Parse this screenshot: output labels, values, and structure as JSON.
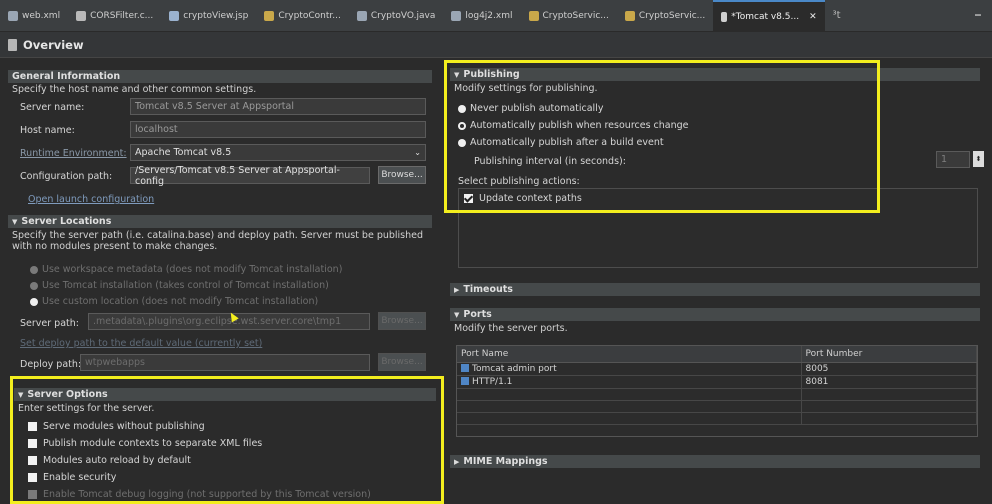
{
  "tabs": [
    {
      "label": "web.xml",
      "icon": "xml-file-icon",
      "color": "#9aa6b4"
    },
    {
      "label": "CORSFilter.c...",
      "icon": "java-file-icon",
      "color": "#b9b9b9"
    },
    {
      "label": "cryptoView.jsp",
      "icon": "jsp-file-icon",
      "color": "#9ab2cf"
    },
    {
      "label": "CryptoContr...",
      "icon": "java-class-icon",
      "color": "#c9a84a"
    },
    {
      "label": "CryptoVO.java",
      "icon": "java-file-icon",
      "color": "#9aa6b4"
    },
    {
      "label": "log4j2.xml",
      "icon": "xml-file-icon",
      "color": "#9aa6b4"
    },
    {
      "label": "CryptoServic...",
      "icon": "java-class-icon",
      "color": "#c9a84a"
    },
    {
      "label": "CryptoServic...",
      "icon": "java-class-icon",
      "color": "#c9a84a"
    },
    {
      "label": "*Tomcat v8.5...",
      "icon": "server-icon",
      "color": "#cfcfcf",
      "active": true
    }
  ],
  "tab_overflow": "³t",
  "editor_title": "Overview",
  "general": {
    "title": "General Information",
    "desc": "Specify the host name and other common settings.",
    "server_name_label": "Server name:",
    "server_name_value": "Tomcat v8.5 Server at Appsportal",
    "host_name_label": "Host name:",
    "host_name_value": "localhost",
    "runtime_label": "Runtime Environment:",
    "runtime_value": "Apache Tomcat v8.5",
    "config_label": "Configuration path:",
    "config_value": "/Servers/Tomcat v8.5 Server at Appsportal-config",
    "browse_label": "Browse...",
    "open_launch": "Open launch configuration"
  },
  "locations": {
    "title": "Server Locations",
    "desc": "Specify the server path (i.e. catalina.base) and deploy path. Server must be published with no modules present to make changes.",
    "opt1": "Use workspace metadata (does not modify Tomcat installation)",
    "opt2": "Use Tomcat installation (takes control of Tomcat installation)",
    "opt3": "Use custom location (does not modify Tomcat installation)",
    "server_path_label": "Server path:",
    "server_path_value": ".metadata\\.plugins\\org.eclipse.wst.server.core\\tmp1",
    "browse_label": "Browse...",
    "set_deploy": "Set deploy path to the default value (currently set)",
    "deploy_label": "Deploy path:",
    "deploy_value": "wtpwebapps",
    "browse2_label": "Browse..."
  },
  "options": {
    "title": "Server Options",
    "desc": "Enter settings for the server.",
    "items": [
      "Serve modules without publishing",
      "Publish module contexts to separate XML files",
      "Modules auto reload by default",
      "Enable security",
      "Enable Tomcat debug logging (not supported by this Tomcat version)"
    ]
  },
  "publishing": {
    "title": "Publishing",
    "desc": "Modify settings for publishing.",
    "opt1": "Never publish automatically",
    "opt2": "Automatically publish when resources change",
    "opt3": "Automatically publish after a build event",
    "interval_label": "Publishing interval (in seconds):",
    "interval_value": "1",
    "actions_label": "Select publishing actions:",
    "action1": "Update context paths"
  },
  "timeouts": {
    "title": "Timeouts"
  },
  "ports": {
    "title": "Ports",
    "desc": "Modify the server ports.",
    "headers": [
      "Port Name",
      "Port Number"
    ],
    "rows": [
      [
        "Tomcat admin port",
        "8005"
      ],
      [
        "HTTP/1.1",
        "8081"
      ]
    ]
  },
  "mime": {
    "title": "MIME Mappings"
  },
  "colors": {
    "highlight": "#f3ee1e",
    "background": "#2b2b2b"
  }
}
